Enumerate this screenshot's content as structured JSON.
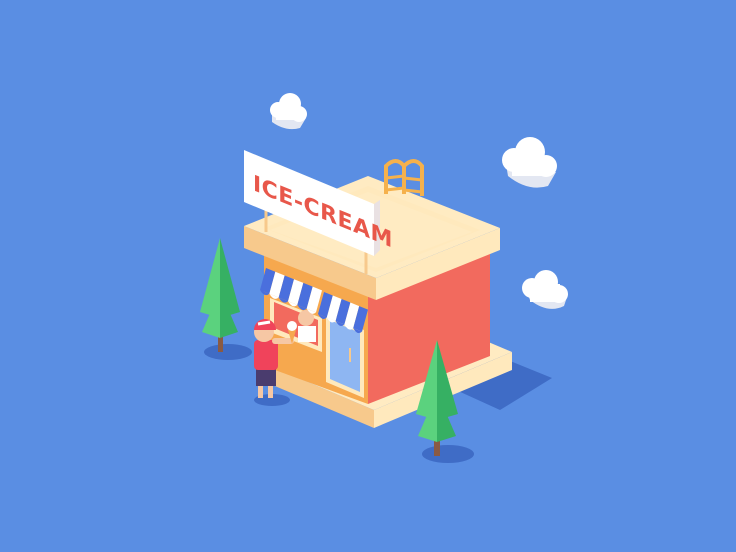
{
  "sign": {
    "text": "ICE-CREAM"
  },
  "colors": {
    "background": "#5A8EE3",
    "shadow": "#3F6CC6",
    "wall_red": "#F26A5E",
    "wall_orange": "#F6A84E",
    "trim_light": "#FFE9BD",
    "trim_mid": "#F7C98C",
    "roof_top": "#FFEBC2",
    "sign_face": "#FFFFFF",
    "sign_side": "#E9E1E3",
    "sign_text": "#E8574A",
    "awning_blue": "#4A6FDD",
    "awning_white": "#FFFFFF",
    "tree_light": "#5BD27E",
    "tree_dark": "#36B063",
    "trunk": "#8A5A44",
    "cloud": "#FFFFFF",
    "cloud_side": "#E3E7F2",
    "ladder": "#F5B14C",
    "door_glass": "#8EB6F2",
    "child_shirt": "#F0435B",
    "child_pants": "#4A3C6E"
  },
  "icons": [
    "cloud-icon",
    "tree-icon",
    "ladder-icon",
    "awning-icon",
    "ice-cream-cone-icon"
  ]
}
